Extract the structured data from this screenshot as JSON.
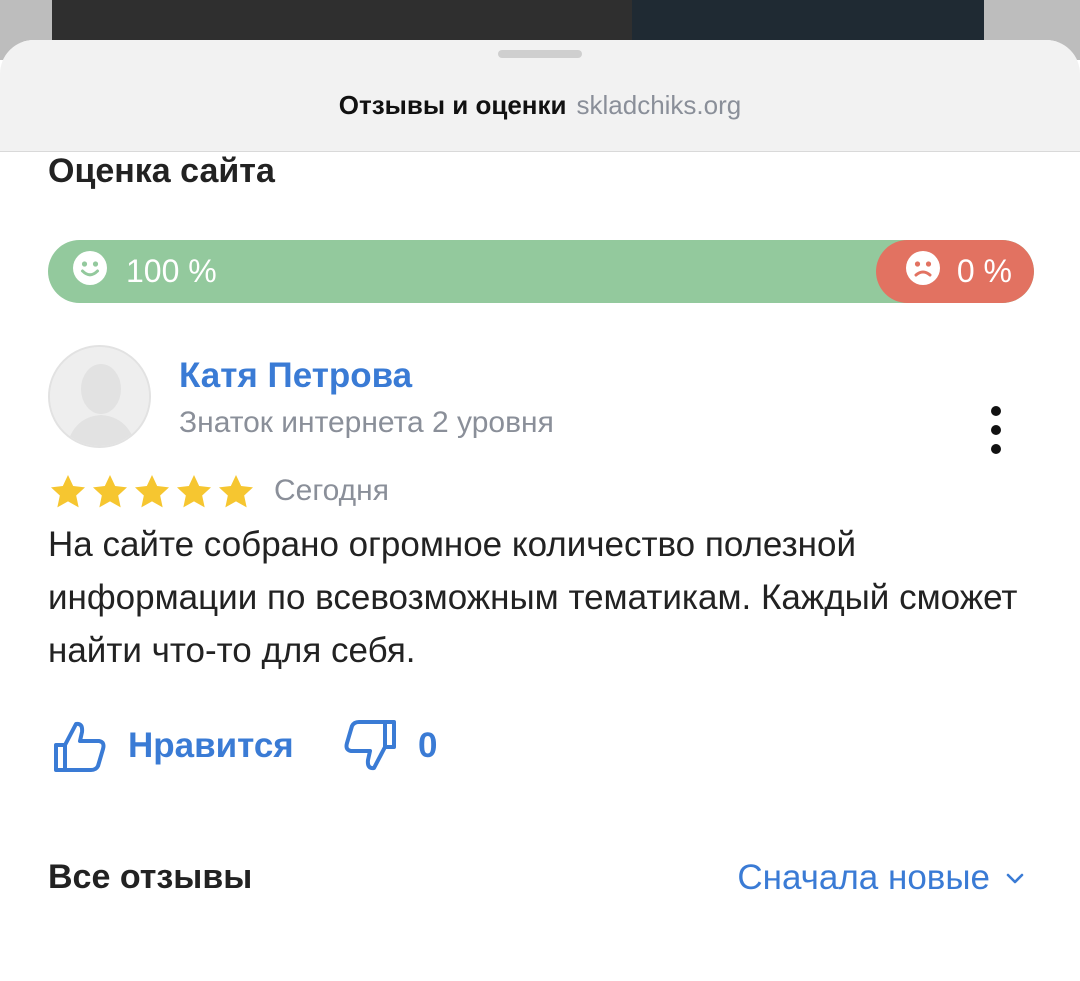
{
  "header": {
    "title": "Отзывы и оценки",
    "domain": "skladchiks.org"
  },
  "site_rating": {
    "title": "Оценка сайта",
    "positive_percent_label": "100 %",
    "negative_percent_label": "0 %",
    "positive_share": 1.0,
    "negative_share": 0.0,
    "positive_color": "#93c99d",
    "negative_color": "#e27261",
    "positive_icon": "smile-icon",
    "negative_icon": "sad-icon"
  },
  "review": {
    "author_name": "Катя Петрова",
    "author_level": "Знаток интернета 2 уровня",
    "avatar_icon": "avatar-placeholder-icon",
    "stars": 5,
    "date": "Сегодня",
    "text": "На сайте собрано огромное количество полезной информации по всевозможным тематикам. Каждый сможет найти что-то для себя.",
    "like_label": "Нравится",
    "dislike_count": "0",
    "more_icon": "more-vertical-icon"
  },
  "all_reviews": {
    "title": "Все отзывы",
    "sort_label": "Сначала новые",
    "sort_icon": "chevron-down-icon"
  },
  "colors": {
    "accent": "#3a7bd5",
    "star": "#f6c630",
    "text_secondary": "#8a8f99"
  }
}
